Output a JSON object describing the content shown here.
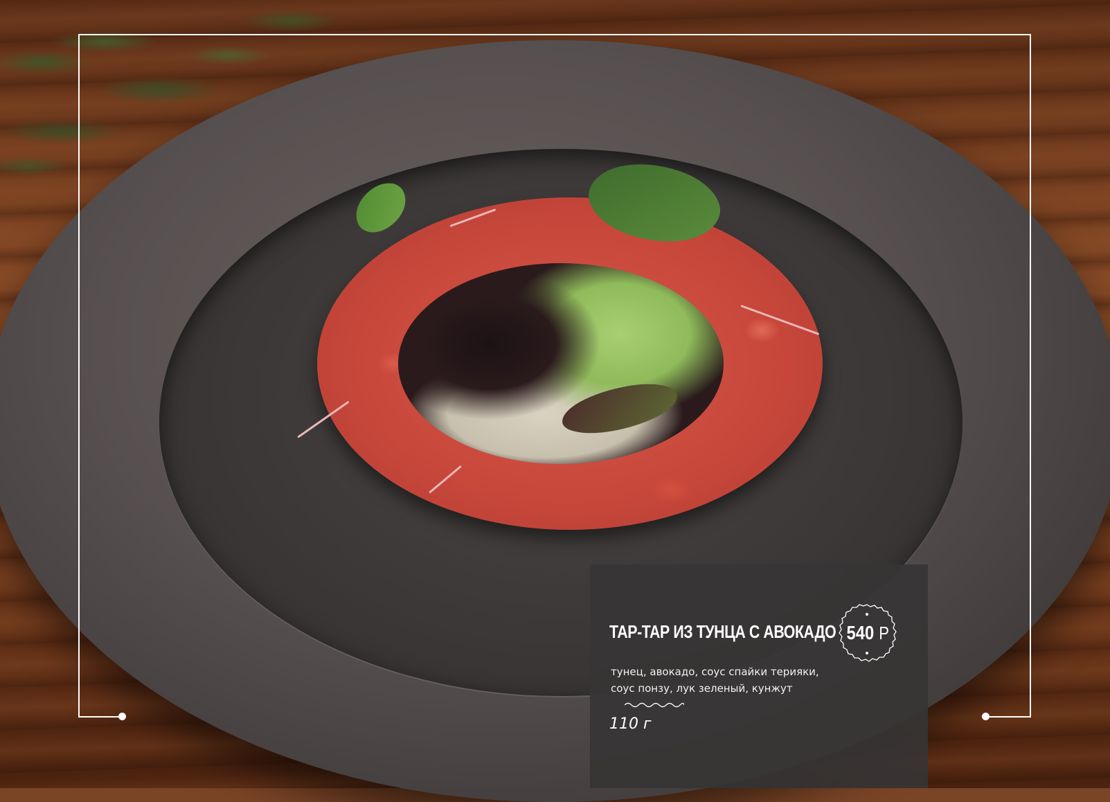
{
  "dish": {
    "title": "ТАР-ТАР ИЗ ТУНЦА С АВОКАДО",
    "description": "тунец, авокадо, соус спайки терияки, соус понзу, лук зеленый, кунжут",
    "weight": "110 г"
  },
  "price": {
    "value": "540",
    "currency": "Р"
  },
  "colors": {
    "card_background": "#373535",
    "frame": "#ffffff",
    "text": "#ffffff"
  },
  "icons": [
    "wave-divider-icon",
    "price-seal-icon"
  ]
}
